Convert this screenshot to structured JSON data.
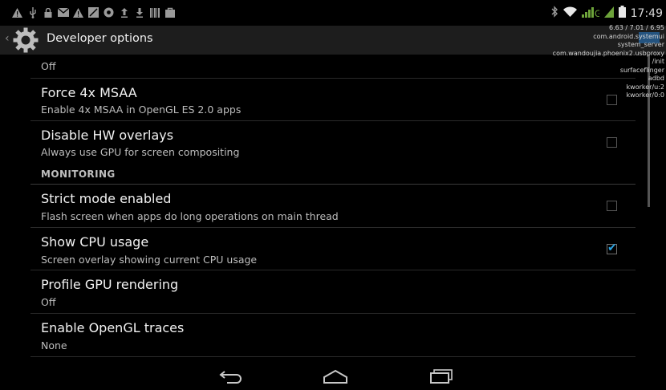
{
  "status_bar": {
    "left_icons": [
      "warning-icon",
      "usb-icon",
      "lock-icon",
      "gmail-icon",
      "warning-icon",
      "image-icon",
      "chrome-icon",
      "upload-icon",
      "download-icon",
      "barcode-icon",
      "bag-icon"
    ],
    "time": "17:49"
  },
  "action_bar": {
    "title": "Developer options"
  },
  "cpu_overlay": {
    "lines": [
      "6.63 / 7.01 / 6.95",
      "com.android.systemui",
      "system_server",
      "com.wandoujia.phoenix2.usbproxy",
      "/init",
      "surfaceflinger",
      "adbd",
      "kworker/u:2",
      "kworker/0:0"
    ]
  },
  "settings": {
    "partial_top": {
      "subtitle": "Off"
    },
    "force_msaa": {
      "title": "Force 4x MSAA",
      "subtitle": "Enable 4x MSAA in OpenGL ES 2.0 apps",
      "checked": false
    },
    "disable_hw_overlays": {
      "title": "Disable HW overlays",
      "subtitle": "Always use GPU for screen compositing",
      "checked": false
    },
    "monitoring_header": "MONITORING",
    "strict_mode": {
      "title": "Strict mode enabled",
      "subtitle": "Flash screen when apps do long operations on main thread",
      "checked": false
    },
    "show_cpu": {
      "title": "Show CPU usage",
      "subtitle": "Screen overlay showing current CPU usage",
      "checked": true
    },
    "profile_gpu": {
      "title": "Profile GPU rendering",
      "subtitle": "Off"
    },
    "opengl_traces": {
      "title": "Enable OpenGL traces",
      "subtitle": "None"
    }
  },
  "colors": {
    "accent": "#2aa4e3",
    "actionbar_bg": "#1d1d1d"
  },
  "nav_bar": {
    "icons": [
      "back-icon",
      "home-icon",
      "recents-icon"
    ]
  }
}
